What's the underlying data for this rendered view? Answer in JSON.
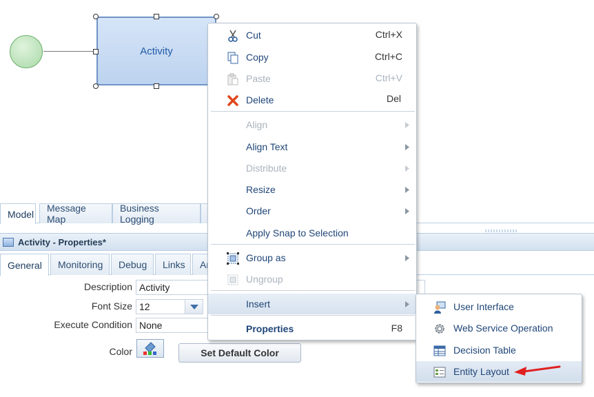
{
  "canvas": {
    "activity_label": "Activity"
  },
  "model_tabs": [
    {
      "label": "Model",
      "active": true
    },
    {
      "label": "Message Map",
      "active": false
    },
    {
      "label": "Business Logging",
      "active": false
    }
  ],
  "properties": {
    "title": "Activity - Properties*",
    "tabs": [
      {
        "label": "General",
        "active": true
      },
      {
        "label": "Monitoring",
        "active": false
      },
      {
        "label": "Debug",
        "active": false
      },
      {
        "label": "Links",
        "active": false
      },
      {
        "label": "Ar",
        "active": false
      }
    ],
    "fields": {
      "description_label": "Description",
      "description_value": "Activity",
      "font_size_label": "Font Size",
      "font_size_value": "12",
      "execute_condition_label": "Execute Condition",
      "execute_condition_value": "None",
      "color_label": "Color",
      "set_default_color_label": "Set Default Color"
    }
  },
  "context_menu": {
    "items": [
      {
        "label": "Cut",
        "shortcut": "Ctrl+X",
        "icon": "scissors-icon",
        "enabled": true
      },
      {
        "label": "Copy",
        "shortcut": "Ctrl+C",
        "icon": "copy-icon",
        "enabled": true
      },
      {
        "label": "Paste",
        "shortcut": "Ctrl+V",
        "icon": "paste-icon",
        "enabled": false
      },
      {
        "label": "Delete",
        "shortcut": "Del",
        "icon": "delete-icon",
        "enabled": true
      },
      {
        "label": "Align",
        "enabled": false,
        "submenu": true
      },
      {
        "label": "Align Text",
        "enabled": true,
        "submenu": true
      },
      {
        "label": "Distribute",
        "enabled": false,
        "submenu": true
      },
      {
        "label": "Resize",
        "enabled": true,
        "submenu": true
      },
      {
        "label": "Order",
        "enabled": true,
        "submenu": true
      },
      {
        "label": "Apply Snap to Selection",
        "enabled": true
      },
      {
        "label": "Group as",
        "icon": "group-icon",
        "enabled": true,
        "submenu": true
      },
      {
        "label": "Ungroup",
        "icon": "ungroup-icon",
        "enabled": false
      },
      {
        "label": "Insert",
        "enabled": true,
        "submenu": true,
        "highlighted": true
      },
      {
        "label": "Properties",
        "shortcut": "F8",
        "enabled": true,
        "bold": true
      }
    ]
  },
  "insert_submenu": {
    "items": [
      {
        "label": "User Interface",
        "icon": "user-interface-icon"
      },
      {
        "label": "Web Service Operation",
        "icon": "gear-icon"
      },
      {
        "label": "Decision Table",
        "icon": "table-icon"
      },
      {
        "label": "Entity Layout",
        "icon": "entity-layout-icon",
        "highlighted": true
      }
    ]
  },
  "colors": {
    "menu_text": "#1f4577",
    "disabled_text": "#a9b3bd",
    "annotation_arrow": "#e02020"
  }
}
